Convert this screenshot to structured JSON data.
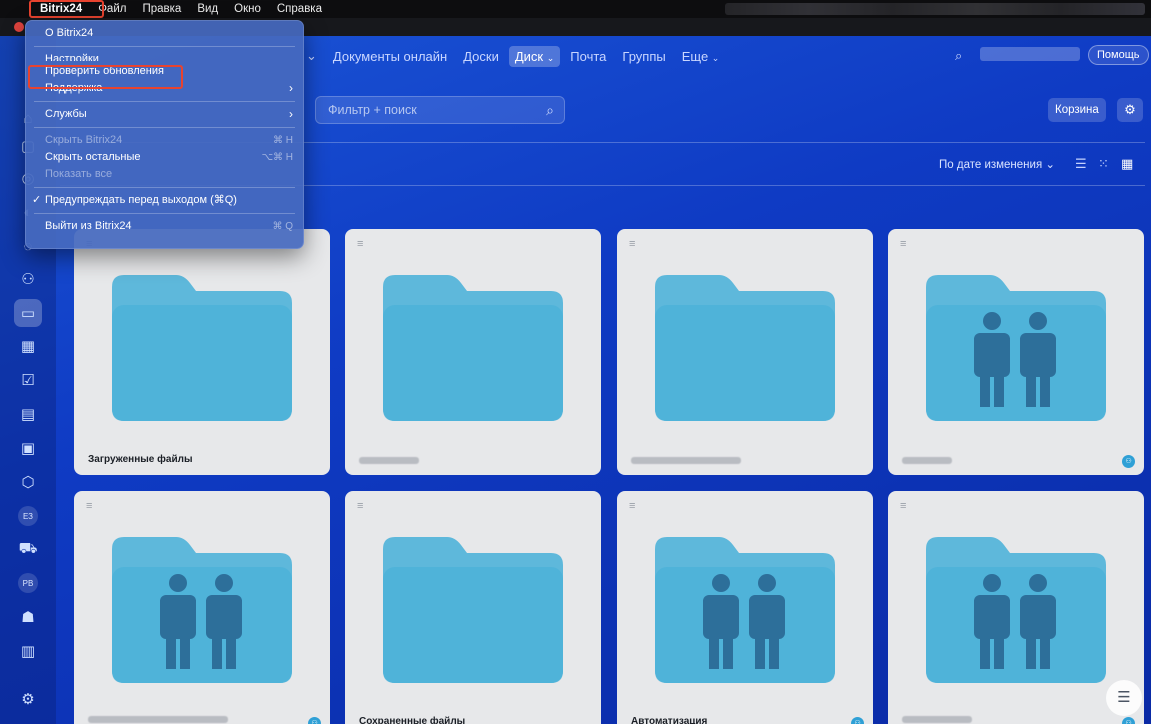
{
  "menubar": {
    "app_name": "Bitrix24",
    "items": [
      "Файл",
      "Правка",
      "Вид",
      "Окно",
      "Справка"
    ]
  },
  "app_menu": {
    "about": "О Bitrix24",
    "settings": "Настройки",
    "check_updates": "Проверить обновления",
    "support": "Поддержка",
    "services": "Службы",
    "hide_app": "Скрыть Bitrix24",
    "hide_app_shortcut": "⌘ H",
    "hide_others": "Скрыть остальные",
    "hide_others_shortcut": "⌥⌘ H",
    "show_all": "Показать все",
    "warn_before_quit": "Предупреждать перед выходом (⌘Q)",
    "quit": "Выйти из Bitrix24",
    "quit_shortcut": "⌘ Q"
  },
  "topnav": {
    "items": [
      "Документы онлайн",
      "Доски",
      "Диск",
      "Почта",
      "Группы",
      "Еще"
    ],
    "active": "Диск",
    "help": "Помощь"
  },
  "toolbar": {
    "filter_placeholder": "Фильтр + поиск",
    "trash": "Корзина",
    "sort_label": "По дате изменения"
  },
  "tiles": [
    {
      "title": "Загруженные файлы",
      "shared": false
    },
    {
      "title": "",
      "shared": false
    },
    {
      "title": "",
      "shared": false
    },
    {
      "title": "",
      "shared": true
    },
    {
      "title": "",
      "shared": true
    },
    {
      "title": "Сохраненные файлы",
      "shared": false
    },
    {
      "title": "Автоматизация",
      "shared": true
    },
    {
      "title": "",
      "shared": true
    }
  ],
  "sidebar_badges": {
    "b1": "ЕЗ",
    "b2": "РВ"
  },
  "colors": {
    "highlight": "#e8432f",
    "folder": "#4fb3d9",
    "tile_bg": "#e7e8ea"
  }
}
